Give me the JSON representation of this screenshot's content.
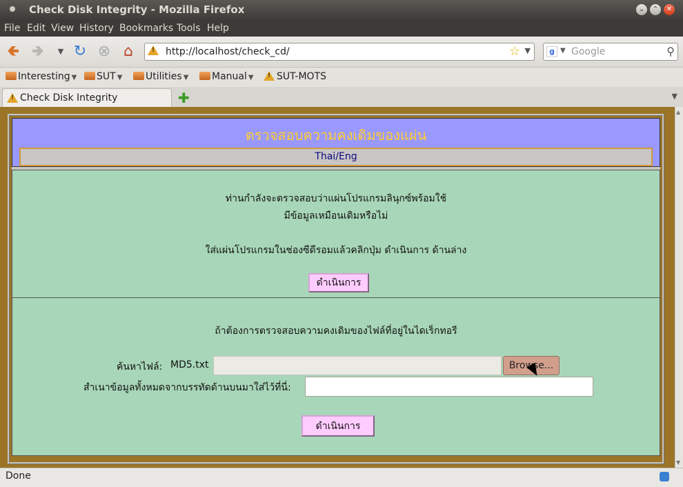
{
  "window": {
    "title": "Check Disk Integrity - Mozilla Firefox"
  },
  "menu": [
    "File",
    "Edit",
    "View",
    "History",
    "Bookmarks",
    "Tools",
    "Help"
  ],
  "nav": {
    "url": "http://localhost/check_cd/",
    "search_placeholder": "Google"
  },
  "bookmarks": [
    "Interesting",
    "SUT",
    "Utilities",
    "Manual",
    "SUT-MOTS"
  ],
  "tab": {
    "title": "Check Disk Integrity"
  },
  "page": {
    "heading": "ตรวจสอบความคงเดิมของแผ่น",
    "lang_link": "Thai/Eng",
    "section1": {
      "line1": "ท่านกำลังจะตรวจสอบว่าแผ่นโปรแกรมลินุกซ์พร้อมใช้",
      "line2": "มีข้อมูลเหมือนเดิมหรือไม่",
      "line3": "ใส่แผ่นโปรแกรมในช่องซีดีรอมแล้วคลิกปุ่ม  ดำเนินการ  ด้านล่าง",
      "button": "ดำเนินการ"
    },
    "section2": {
      "intro": "ถ้าต้องการตรวจสอบความคงเดิมของไฟล์ที่อยู่ในไดเร็กทอรี",
      "file_label": "ค้นหาไฟล์:",
      "file_name": "MD5.txt",
      "browse_label": "Browse...",
      "paste_label": "สำเนาข้อมูลทั้งหมดจากบรรทัดด้านบนมาใส่ไว้ที่นี่:",
      "paste_value": "",
      "button": "ดำเนินการ"
    }
  },
  "status": {
    "text": "Done"
  },
  "colors": {
    "page_bg": "#9b7428",
    "header_bg": "#9999ff",
    "heading_text": "#ffcc33",
    "panel_bg": "#a8d6b8",
    "button_bg": "#ffccff"
  }
}
